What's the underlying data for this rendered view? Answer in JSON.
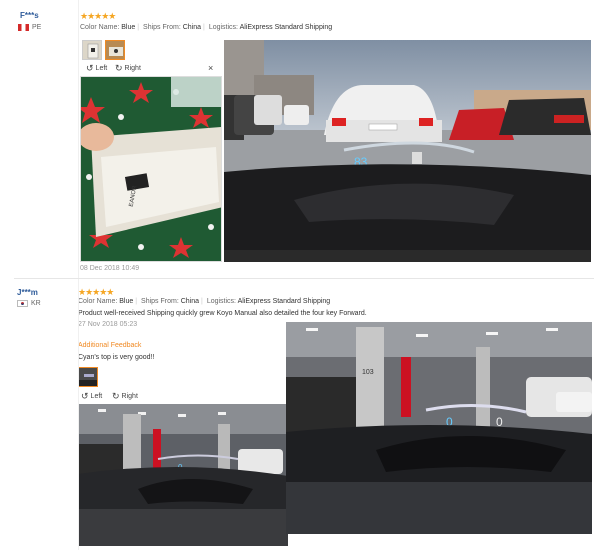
{
  "reviews": [
    {
      "user": "F***s",
      "country": "PE",
      "stars": "★★★★★",
      "color_label": "Color Name:",
      "color_value": "Blue",
      "ships_label": "Ships From:",
      "ships_value": "China",
      "logistics_label": "Logistics:",
      "logistics_value": "AliExpress Standard Shipping",
      "viewer": {
        "left_label": "Left",
        "right_label": "Right",
        "close": "×"
      },
      "product_box_brand": "EANOR",
      "hud_speed": "83",
      "date": "08 Dec 2018 10:49"
    },
    {
      "user": "J***m",
      "country": "KR",
      "stars": "★★★★★",
      "color_label": "Color Name:",
      "color_value": "Blue",
      "ships_label": "Ships From:",
      "ships_value": "China",
      "logistics_label": "Logistics:",
      "logistics_value": "AliExpress Standard Shipping",
      "text": "Product well-received Shipping quickly grew Koyo Manual also detailed the four key Forward.",
      "date": "27 Nov 2018 05:23",
      "additional_label": "Additional Feedback",
      "additional_text": "Cyan's top is very good!!",
      "viewer": {
        "left_label": "Left",
        "right_label": "Right"
      },
      "hud_speed": "0",
      "hud_unit": "0",
      "parking_sign": "103"
    }
  ],
  "icons": {
    "rotate_left": "↺",
    "rotate_right": "↻"
  }
}
